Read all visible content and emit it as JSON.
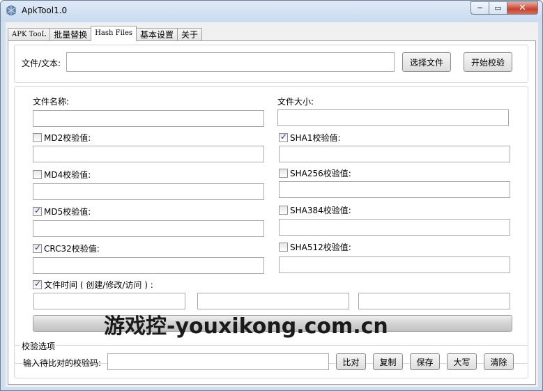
{
  "window": {
    "title": "ApkTool1.0",
    "controls": {
      "minimize": "─",
      "maximize": "▭",
      "close": "✕"
    }
  },
  "tabs": [
    {
      "label": "APK TooL",
      "active": false
    },
    {
      "label": "批量替换",
      "active": false
    },
    {
      "label": "Hash Files",
      "active": true
    },
    {
      "label": "基本设置",
      "active": false
    },
    {
      "label": "关于",
      "active": false
    }
  ],
  "file_input": {
    "label": "文件/文本:",
    "value": "",
    "choose_button": "选择文件",
    "start_button": "开始校验"
  },
  "results": {
    "file_name": {
      "label": "文件名称:",
      "value": ""
    },
    "file_size": {
      "label": "文件大小:",
      "value": ""
    },
    "md2": {
      "label": "MD2校验值:",
      "checked": false,
      "value": ""
    },
    "sha1": {
      "label": "SHA1校验值:",
      "checked": true,
      "value": ""
    },
    "md4": {
      "label": "MD4校验值:",
      "checked": false,
      "value": ""
    },
    "sha256": {
      "label": "SHA256校验值:",
      "checked": false,
      "value": ""
    },
    "md5": {
      "label": "MD5校验值:",
      "checked": true,
      "value": ""
    },
    "sha384": {
      "label": "SHA384校验值:",
      "checked": false,
      "value": ""
    },
    "crc32": {
      "label": "CRC32校验值:",
      "checked": true,
      "value": ""
    },
    "sha512": {
      "label": "SHA512校验值:",
      "checked": false,
      "value": ""
    },
    "file_time": {
      "label": "文件时间 ( 创建/修改/访问 ) :",
      "checked": true,
      "created": "",
      "modified": "",
      "accessed": ""
    }
  },
  "progress": {
    "fraction": 0
  },
  "watermark": "游戏控-youxikong.com.cn",
  "verify": {
    "legend": "校验选项",
    "input_label": "输入待比对的校验码:",
    "value": "",
    "buttons": {
      "compare": "比对",
      "copy": "复制",
      "save": "保存",
      "upper": "大写",
      "clear": "清除"
    }
  },
  "colors": {
    "titlebar": "#c9dbef",
    "window_border": "#6d7f96",
    "close_button": "#c8422f",
    "panel": "#ffffff",
    "client": "#f0f0f0"
  }
}
